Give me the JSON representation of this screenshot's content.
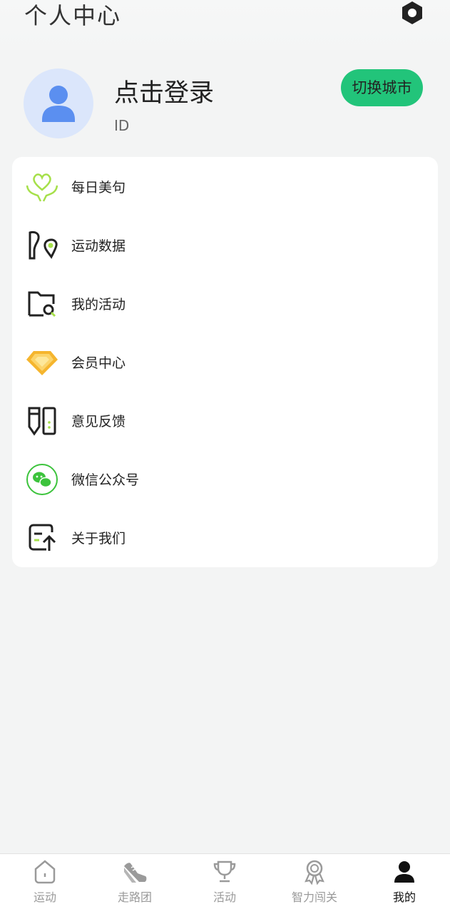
{
  "header": {
    "title": "个人中心"
  },
  "profile": {
    "login_text": "点击登录",
    "id_label": "ID",
    "city_button": "切换城市"
  },
  "menu": {
    "items": [
      {
        "label": "每日美句",
        "icon": "heart-hands-icon"
      },
      {
        "label": "运动数据",
        "icon": "shoe-location-icon"
      },
      {
        "label": "我的活动",
        "icon": "folder-search-icon"
      },
      {
        "label": "会员中心",
        "icon": "diamond-icon"
      },
      {
        "label": "意见反馈",
        "icon": "feedback-icon"
      },
      {
        "label": "微信公众号",
        "icon": "wechat-icon"
      },
      {
        "label": "关于我们",
        "icon": "about-icon"
      }
    ]
  },
  "tabbar": {
    "tabs": [
      {
        "label": "运动",
        "icon": "house-icon"
      },
      {
        "label": "走路团",
        "icon": "sneaker-icon"
      },
      {
        "label": "活动",
        "icon": "trophy-icon"
      },
      {
        "label": "智力闯关",
        "icon": "medal-icon"
      },
      {
        "label": "我的",
        "icon": "user-icon",
        "active": true
      }
    ]
  },
  "colors": {
    "accent": "#22c47a",
    "avatar_bg": "#dbe6fb",
    "avatar_fg": "#5b8ff0",
    "diamond": "#f5b52e",
    "wechat": "#3cc33c"
  }
}
